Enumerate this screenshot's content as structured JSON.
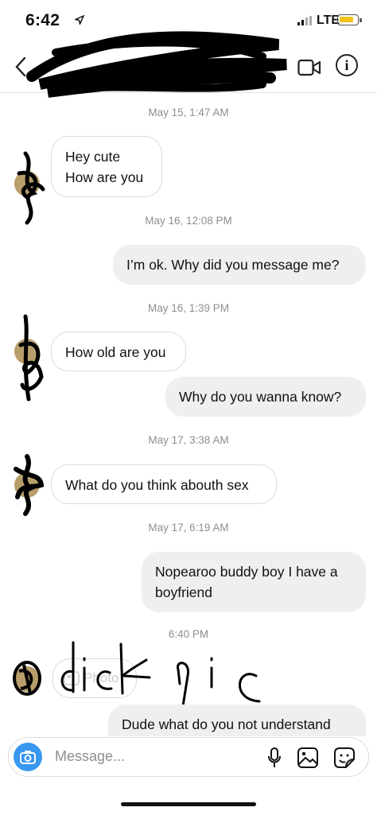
{
  "status_bar": {
    "time": "6:42",
    "network": "LTE"
  },
  "header": {
    "back_icon": "chevron-left-icon",
    "video_icon": "video-camera-icon",
    "info_icon": "info-icon",
    "info_glyph": "i"
  },
  "timestamps": {
    "t1": "May 15, 1:47 AM",
    "t2": "May 16, 12:08 PM",
    "t3": "May 16, 1:39 PM",
    "t4": "May 17, 3:38 AM",
    "t5": "May 17, 6:19 AM",
    "t6": "6:40 PM"
  },
  "messages": {
    "m1_line1": "Hey cute",
    "m1_line2": "How are you",
    "m2": "I’m ok. Why did you message me?",
    "m3": "How old are you",
    "m4": "Why do you wanna know?",
    "m5": "What do you think abouth sex",
    "m6_line1": "Nopearoo buddy boy I have a",
    "m6_line2": "boyfriend",
    "photo_label": "Photo",
    "m7": "Dude what do you not understand"
  },
  "composer": {
    "placeholder": "Message...",
    "camera_icon": "camera-icon",
    "mic_icon": "microphone-icon",
    "gallery_icon": "gallery-icon",
    "sticker_icon": "sticker-icon"
  },
  "colors": {
    "accent": "#3897f0",
    "outgoing_bubble": "#efefef",
    "timestamp": "#8e8e8e"
  }
}
